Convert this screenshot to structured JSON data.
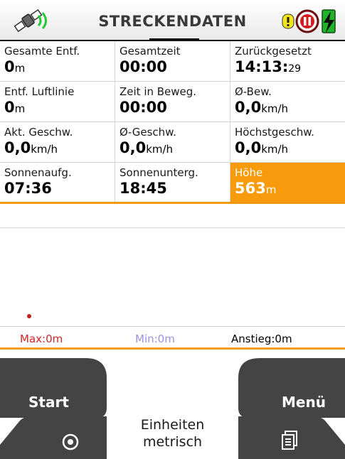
{
  "header": {
    "title": "STRECKENDATEN",
    "icons": [
      "satellite-icon",
      "info-icon",
      "pause-icon",
      "battery-charging-icon"
    ]
  },
  "cells": [
    {
      "label": "Gesamte Entf.",
      "value": "0",
      "unit": "m"
    },
    {
      "label": "Gesamtzeit",
      "value": "00:00"
    },
    {
      "label": "Zurückgesetzt",
      "value": "14:13:",
      "suffix": "29"
    },
    {
      "label": "Entf. Luftlinie",
      "value": "0",
      "unit": "m"
    },
    {
      "label": "Zeit in Beweg.",
      "value": "00:00"
    },
    {
      "label": "Ø-Bew.",
      "value": "0,0",
      "unit": "km/h"
    },
    {
      "label": "Akt. Geschw.",
      "value": "0,0",
      "unit": "km/h"
    },
    {
      "label": "Ø-Geschw.",
      "value": "0,0",
      "unit": "km/h"
    },
    {
      "label": "Höchstgeschw.",
      "value": "0,0",
      "unit": "km/h"
    },
    {
      "label": "Sonnenaufg.",
      "value": "07:36"
    },
    {
      "label": "Sonnenunterg.",
      "value": "18:45"
    },
    {
      "label": "Höhe",
      "value": "563",
      "unit": "m"
    }
  ],
  "stats": {
    "max": "Max:0m",
    "min": "Min:0m",
    "rise": "Anstieg:0m"
  },
  "buttons": {
    "start": "Start",
    "menu": "Menü",
    "target_icon": "target-icon",
    "pages_icon": "pages-icon"
  },
  "units": {
    "line1": "Einheiten",
    "line2": "metrisch"
  },
  "colors": {
    "accent": "#f79a0c",
    "button": "#444444",
    "max": "#d42626",
    "min": "#9a93e0"
  }
}
